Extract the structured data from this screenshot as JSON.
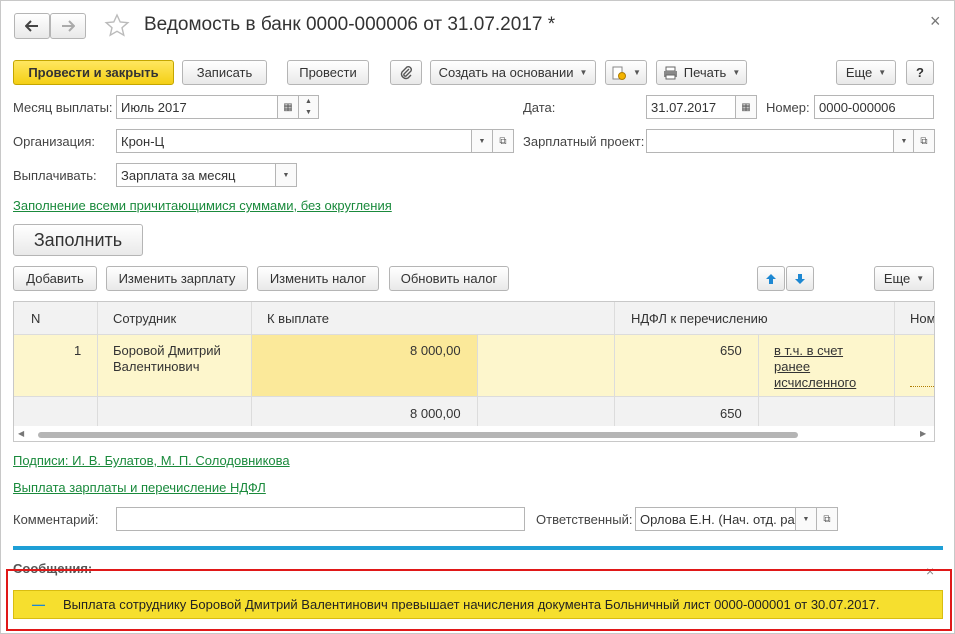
{
  "window": {
    "title": "Ведомость в банк 0000-000006 от 31.07.2017 *",
    "close_glyph": "×"
  },
  "toolbar": {
    "post_close": "Провести и закрыть",
    "save": "Записать",
    "post": "Провести",
    "create_based": "Создать на основании",
    "print": "Печать",
    "more": "Еще",
    "help": "?"
  },
  "form": {
    "pay_month_label": "Месяц выплаты:",
    "pay_month_value": "Июль 2017",
    "date_label": "Дата:",
    "date_value": "31.07.2017",
    "number_label": "Номер:",
    "number_value": "0000-000006",
    "org_label": "Организация:",
    "org_value": "Крон-Ц",
    "salary_project_label": "Зарплатный проект:",
    "salary_project_value": "",
    "pay_type_label": "Выплачивать:",
    "pay_type_value": "Зарплата за месяц",
    "fill_mode_link": "Заполнение всеми причитающимися суммами, без округления",
    "fill_button": "Заполнить"
  },
  "table_toolbar": {
    "add": "Добавить",
    "edit_salary": "Изменить зарплату",
    "edit_tax": "Изменить налог",
    "update_tax": "Обновить налог",
    "more": "Еще"
  },
  "table": {
    "headers": {
      "n": "N",
      "employee": "Сотрудник",
      "to_pay": "К выплате",
      "ndfl": "НДФЛ к перечислению",
      "extra": "Ном"
    },
    "rows": [
      {
        "n": "1",
        "employee_line1": "Боровой Дмитрий",
        "employee_line2": "Валентинович",
        "to_pay": "8 000,00",
        "ndfl": "650",
        "ndfl_link1": "в т.ч. в счет",
        "ndfl_link2": "ранее",
        "ndfl_link3": "исчисленного"
      }
    ],
    "footer": {
      "to_pay": "8 000,00",
      "ndfl": "650"
    }
  },
  "signatures_link": "Подписи: И. В. Булатов, М. П. Солодовникова",
  "payment_link": "Выплата зарплаты и перечисление НДФЛ",
  "comment_label": "Комментарий:",
  "comment_value": "",
  "responsible_label": "Ответственный:",
  "responsible_value": "Орлова Е.Н. (Нач. отд. ра",
  "messages": {
    "title": "Сообщения:",
    "close_glyph": "×",
    "dash": "—",
    "text": "Выплата сотруднику Боровой Дмитрий Валентинович превышает начисления документа Больничный лист 0000-000001 от 30.07.2017."
  },
  "colors": {
    "accent_yellow": "#f4cf15",
    "link_green": "#1a8a3c",
    "blue_bar": "#1e9fd6",
    "highlight_red": "#e01818",
    "row_selected": "#fdf6cc",
    "message_yellow": "#f6df2e"
  }
}
